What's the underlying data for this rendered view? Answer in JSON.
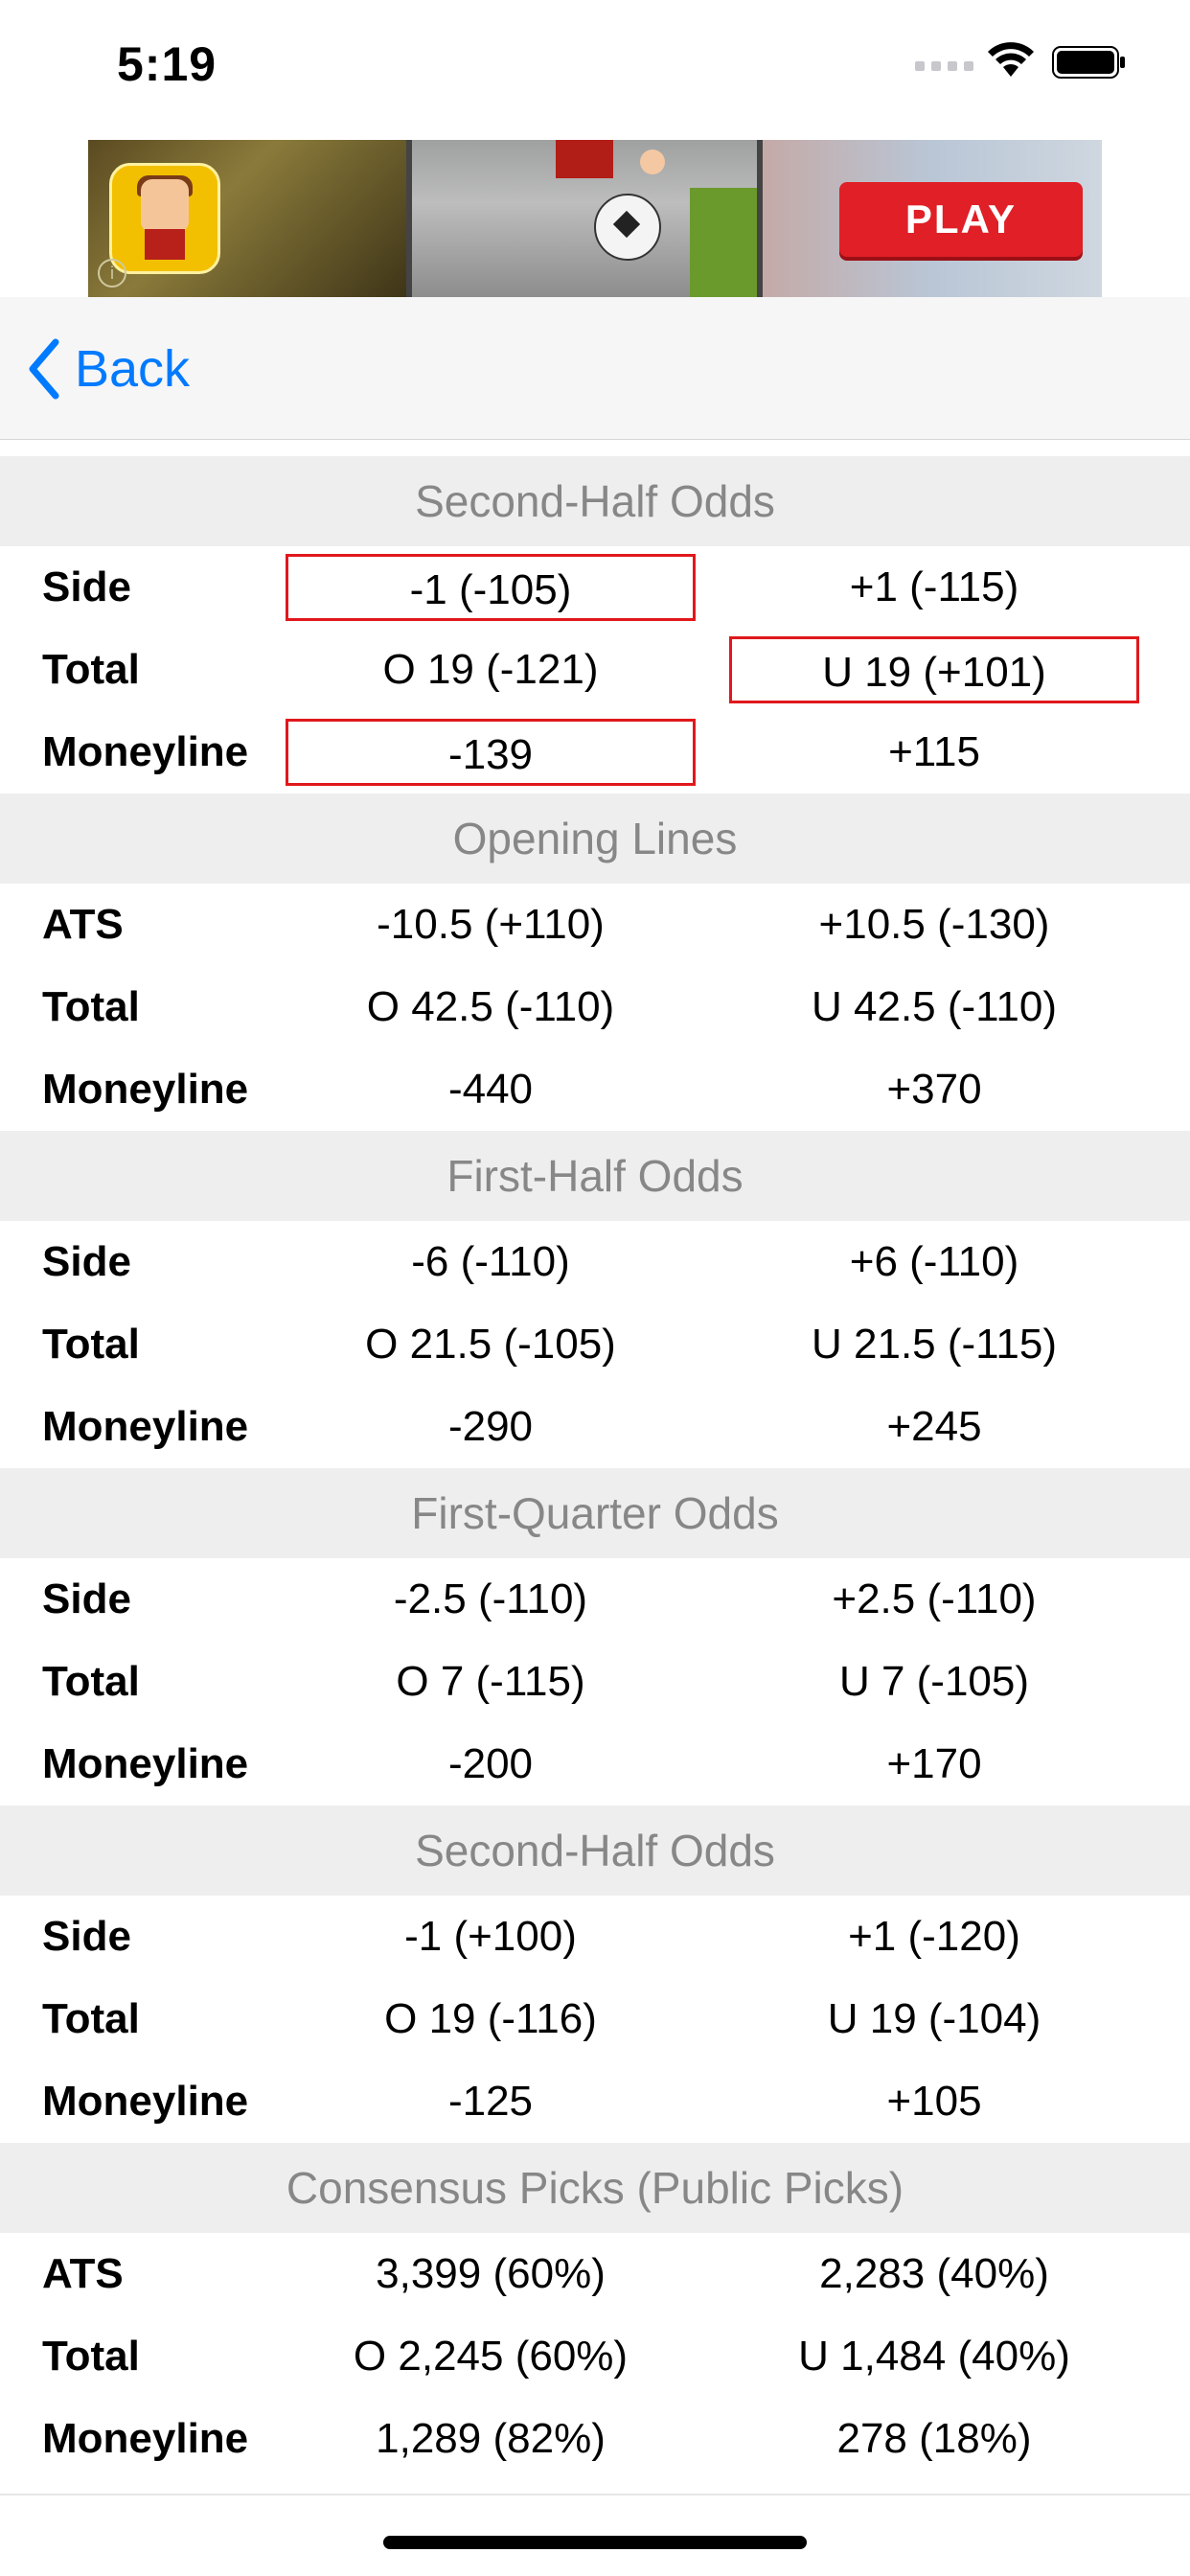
{
  "status_bar": {
    "time": "5:19"
  },
  "ad": {
    "cta_label": "PLAY",
    "info_glyph": "i"
  },
  "nav": {
    "back_label": "Back"
  },
  "sections": [
    {
      "header": "Second-Half Odds",
      "rows": [
        {
          "label": "Side",
          "col1": "-1 (-105)",
          "col2": "+1 (-115)"
        },
        {
          "label": "Total",
          "col1": "O 19 (-121)",
          "col2": "U 19 (+101)"
        },
        {
          "label": "Moneyline",
          "col1": "-139",
          "col2": "+115"
        }
      ]
    },
    {
      "header": "Opening Lines",
      "rows": [
        {
          "label": "ATS",
          "col1": "-10.5 (+110)",
          "col2": "+10.5 (-130)"
        },
        {
          "label": "Total",
          "col1": "O 42.5 (-110)",
          "col2": "U 42.5 (-110)"
        },
        {
          "label": "Moneyline",
          "col1": "-440",
          "col2": "+370"
        }
      ]
    },
    {
      "header": "First-Half Odds",
      "rows": [
        {
          "label": "Side",
          "col1": "-6 (-110)",
          "col2": "+6 (-110)"
        },
        {
          "label": "Total",
          "col1": "O 21.5 (-105)",
          "col2": "U 21.5 (-115)"
        },
        {
          "label": "Moneyline",
          "col1": "-290",
          "col2": "+245"
        }
      ]
    },
    {
      "header": "First-Quarter Odds",
      "rows": [
        {
          "label": "Side",
          "col1": "-2.5 (-110)",
          "col2": "+2.5 (-110)"
        },
        {
          "label": "Total",
          "col1": "O 7 (-115)",
          "col2": "U 7 (-105)"
        },
        {
          "label": "Moneyline",
          "col1": "-200",
          "col2": "+170"
        }
      ]
    },
    {
      "header": "Second-Half Odds",
      "rows": [
        {
          "label": "Side",
          "col1": "-1 (+100)",
          "col2": "+1 (-120)"
        },
        {
          "label": "Total",
          "col1": "O 19 (-116)",
          "col2": "U 19 (-104)"
        },
        {
          "label": "Moneyline",
          "col1": "-125",
          "col2": "+105"
        }
      ]
    },
    {
      "header": "Consensus Picks (Public Picks)",
      "rows": [
        {
          "label": "ATS",
          "col1": "3,399 (60%)",
          "col2": "2,283 (40%)"
        },
        {
          "label": "Total",
          "col1": "O 2,245 (60%)",
          "col2": "U 1,484 (40%)"
        },
        {
          "label": "Moneyline",
          "col1": "1,289 (82%)",
          "col2": "278 (18%)"
        }
      ]
    }
  ],
  "colors": {
    "accent": "#007aff",
    "highlight_border": "#e0181c",
    "section_header_bg": "#eeeeee",
    "section_header_text": "#878787",
    "nav_bar_bg": "#f6f6f6"
  },
  "icons": {
    "back": "chevron-left-icon",
    "wifi": "wifi-icon",
    "battery": "battery-icon",
    "signal": "cellular-signal-icon"
  }
}
